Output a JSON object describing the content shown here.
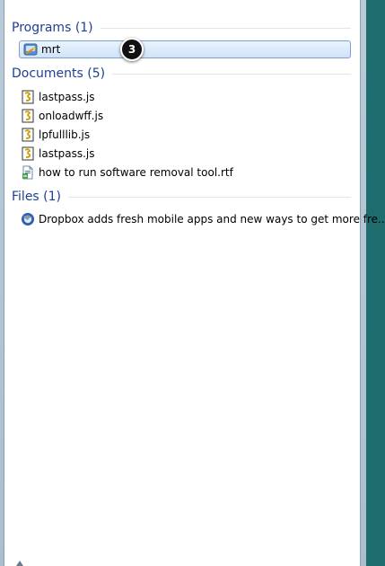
{
  "sections": {
    "programs": {
      "title": "Programs (1)",
      "items": [
        {
          "label": "mrt",
          "icon": "removal-tool-icon",
          "selected": true
        }
      ]
    },
    "documents": {
      "title": "Documents (5)",
      "items": [
        {
          "label": "lastpass.js",
          "icon": "script-file-icon"
        },
        {
          "label": "onloadwff.js",
          "icon": "script-file-icon"
        },
        {
          "label": "lpfulllib.js",
          "icon": "script-file-icon"
        },
        {
          "label": "lastpass.js",
          "icon": "script-file-icon"
        },
        {
          "label": "how to run software removal tool.rtf",
          "icon": "rtf-document-icon"
        }
      ]
    },
    "files": {
      "title": "Files (1)",
      "items": [
        {
          "label": "Dropbox adds fresh mobile apps and new ways to get more fre...",
          "icon": "thunderbird-mail-icon"
        }
      ]
    }
  },
  "callout": {
    "number": "3"
  },
  "colors": {
    "section_title": "#1e3f94",
    "selection": "#cfe3f8",
    "desktop": "#1e6a6c"
  }
}
